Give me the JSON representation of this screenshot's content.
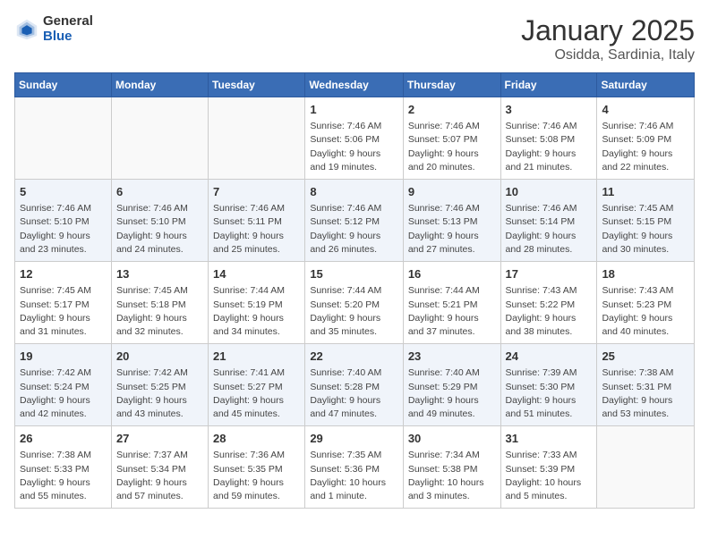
{
  "header": {
    "logo_general": "General",
    "logo_blue": "Blue",
    "title": "January 2025",
    "subtitle": "Osidda, Sardinia, Italy"
  },
  "weekdays": [
    "Sunday",
    "Monday",
    "Tuesday",
    "Wednesday",
    "Thursday",
    "Friday",
    "Saturday"
  ],
  "weeks": [
    [
      {
        "day": "",
        "info": ""
      },
      {
        "day": "",
        "info": ""
      },
      {
        "day": "",
        "info": ""
      },
      {
        "day": "1",
        "info": "Sunrise: 7:46 AM\nSunset: 5:06 PM\nDaylight: 9 hours\nand 19 minutes."
      },
      {
        "day": "2",
        "info": "Sunrise: 7:46 AM\nSunset: 5:07 PM\nDaylight: 9 hours\nand 20 minutes."
      },
      {
        "day": "3",
        "info": "Sunrise: 7:46 AM\nSunset: 5:08 PM\nDaylight: 9 hours\nand 21 minutes."
      },
      {
        "day": "4",
        "info": "Sunrise: 7:46 AM\nSunset: 5:09 PM\nDaylight: 9 hours\nand 22 minutes."
      }
    ],
    [
      {
        "day": "5",
        "info": "Sunrise: 7:46 AM\nSunset: 5:10 PM\nDaylight: 9 hours\nand 23 minutes."
      },
      {
        "day": "6",
        "info": "Sunrise: 7:46 AM\nSunset: 5:10 PM\nDaylight: 9 hours\nand 24 minutes."
      },
      {
        "day": "7",
        "info": "Sunrise: 7:46 AM\nSunset: 5:11 PM\nDaylight: 9 hours\nand 25 minutes."
      },
      {
        "day": "8",
        "info": "Sunrise: 7:46 AM\nSunset: 5:12 PM\nDaylight: 9 hours\nand 26 minutes."
      },
      {
        "day": "9",
        "info": "Sunrise: 7:46 AM\nSunset: 5:13 PM\nDaylight: 9 hours\nand 27 minutes."
      },
      {
        "day": "10",
        "info": "Sunrise: 7:46 AM\nSunset: 5:14 PM\nDaylight: 9 hours\nand 28 minutes."
      },
      {
        "day": "11",
        "info": "Sunrise: 7:45 AM\nSunset: 5:15 PM\nDaylight: 9 hours\nand 30 minutes."
      }
    ],
    [
      {
        "day": "12",
        "info": "Sunrise: 7:45 AM\nSunset: 5:17 PM\nDaylight: 9 hours\nand 31 minutes."
      },
      {
        "day": "13",
        "info": "Sunrise: 7:45 AM\nSunset: 5:18 PM\nDaylight: 9 hours\nand 32 minutes."
      },
      {
        "day": "14",
        "info": "Sunrise: 7:44 AM\nSunset: 5:19 PM\nDaylight: 9 hours\nand 34 minutes."
      },
      {
        "day": "15",
        "info": "Sunrise: 7:44 AM\nSunset: 5:20 PM\nDaylight: 9 hours\nand 35 minutes."
      },
      {
        "day": "16",
        "info": "Sunrise: 7:44 AM\nSunset: 5:21 PM\nDaylight: 9 hours\nand 37 minutes."
      },
      {
        "day": "17",
        "info": "Sunrise: 7:43 AM\nSunset: 5:22 PM\nDaylight: 9 hours\nand 38 minutes."
      },
      {
        "day": "18",
        "info": "Sunrise: 7:43 AM\nSunset: 5:23 PM\nDaylight: 9 hours\nand 40 minutes."
      }
    ],
    [
      {
        "day": "19",
        "info": "Sunrise: 7:42 AM\nSunset: 5:24 PM\nDaylight: 9 hours\nand 42 minutes."
      },
      {
        "day": "20",
        "info": "Sunrise: 7:42 AM\nSunset: 5:25 PM\nDaylight: 9 hours\nand 43 minutes."
      },
      {
        "day": "21",
        "info": "Sunrise: 7:41 AM\nSunset: 5:27 PM\nDaylight: 9 hours\nand 45 minutes."
      },
      {
        "day": "22",
        "info": "Sunrise: 7:40 AM\nSunset: 5:28 PM\nDaylight: 9 hours\nand 47 minutes."
      },
      {
        "day": "23",
        "info": "Sunrise: 7:40 AM\nSunset: 5:29 PM\nDaylight: 9 hours\nand 49 minutes."
      },
      {
        "day": "24",
        "info": "Sunrise: 7:39 AM\nSunset: 5:30 PM\nDaylight: 9 hours\nand 51 minutes."
      },
      {
        "day": "25",
        "info": "Sunrise: 7:38 AM\nSunset: 5:31 PM\nDaylight: 9 hours\nand 53 minutes."
      }
    ],
    [
      {
        "day": "26",
        "info": "Sunrise: 7:38 AM\nSunset: 5:33 PM\nDaylight: 9 hours\nand 55 minutes."
      },
      {
        "day": "27",
        "info": "Sunrise: 7:37 AM\nSunset: 5:34 PM\nDaylight: 9 hours\nand 57 minutes."
      },
      {
        "day": "28",
        "info": "Sunrise: 7:36 AM\nSunset: 5:35 PM\nDaylight: 9 hours\nand 59 minutes."
      },
      {
        "day": "29",
        "info": "Sunrise: 7:35 AM\nSunset: 5:36 PM\nDaylight: 10 hours\nand 1 minute."
      },
      {
        "day": "30",
        "info": "Sunrise: 7:34 AM\nSunset: 5:38 PM\nDaylight: 10 hours\nand 3 minutes."
      },
      {
        "day": "31",
        "info": "Sunrise: 7:33 AM\nSunset: 5:39 PM\nDaylight: 10 hours\nand 5 minutes."
      },
      {
        "day": "",
        "info": ""
      }
    ]
  ]
}
